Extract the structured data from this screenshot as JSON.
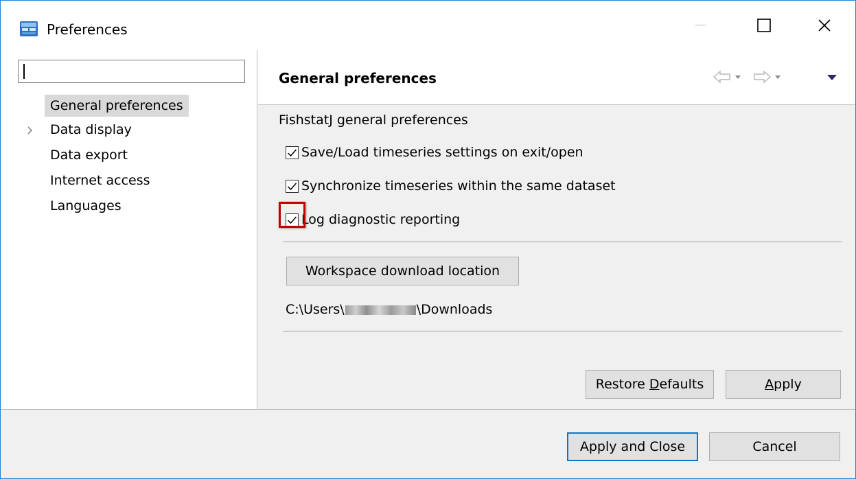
{
  "window": {
    "title": "Preferences",
    "app_icon": "preferences-app-icon",
    "controls": {
      "minimize": "—",
      "maximize": "☐",
      "close": "✕"
    }
  },
  "sidebar": {
    "filter_value": "",
    "items": [
      {
        "label": "General preferences",
        "selected": true
      },
      {
        "label": "Data display",
        "expandable": true
      },
      {
        "label": "Data export"
      },
      {
        "label": "Internet access"
      },
      {
        "label": "Languages"
      }
    ]
  },
  "page": {
    "title": "General preferences",
    "section_label": "FishstatJ general preferences",
    "checkboxes": [
      {
        "label": "Save/Load timeseries settings on exit/open",
        "checked": true
      },
      {
        "label": "Synchronize timeseries within the same dataset",
        "checked": true
      },
      {
        "label": "Log diagnostic reporting",
        "checked": true,
        "highlighted": true
      }
    ],
    "workspace_button": "Workspace download location",
    "path_prefix": "C:\\Users\\",
    "path_suffix": "\\Downloads",
    "restore_defaults": {
      "before": "Restore ",
      "mnemonic": "D",
      "after": "efaults"
    },
    "apply": {
      "mnemonic": "A",
      "after": "pply"
    }
  },
  "footer": {
    "apply_and_close": "Apply and Close",
    "cancel": "Cancel"
  },
  "colors": {
    "highlight": "#c00000",
    "default_button_border": "#0078d7",
    "window_border": "#1883d7"
  }
}
